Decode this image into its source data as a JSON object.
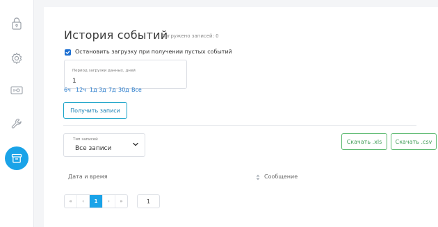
{
  "sidebar": {
    "items": [
      {
        "icon": "lock-icon"
      },
      {
        "icon": "gear-icon"
      },
      {
        "icon": "key-card-icon"
      },
      {
        "icon": "wrench-icon"
      },
      {
        "icon": "archive-icon",
        "active": true
      }
    ],
    "accent": "#1aa3e8"
  },
  "header": {
    "title": "История событий",
    "loaded": "Загружено записей: 0"
  },
  "options": {
    "stop_on_empty_label": "Остановить загрузку при получении пустых событий",
    "stop_on_empty_checked": true
  },
  "period": {
    "label": "Период загрузки данных, дней",
    "value": "1"
  },
  "quick_ranges": [
    "6ч",
    "12ч",
    "1д",
    "3д",
    "7д",
    "30д",
    "Все"
  ],
  "actions": {
    "get_records": "Получить записи",
    "download_xls": "Скачать .xls",
    "download_csv": "Скачать .csv"
  },
  "record_type": {
    "label": "Тип записей",
    "value": "Все записи"
  },
  "table": {
    "columns": [
      "Дата и время",
      "Сообщение"
    ]
  },
  "pagination": {
    "first": "«",
    "prev": "‹",
    "current": "1",
    "next": "›",
    "last": "»",
    "goto_value": "1"
  }
}
